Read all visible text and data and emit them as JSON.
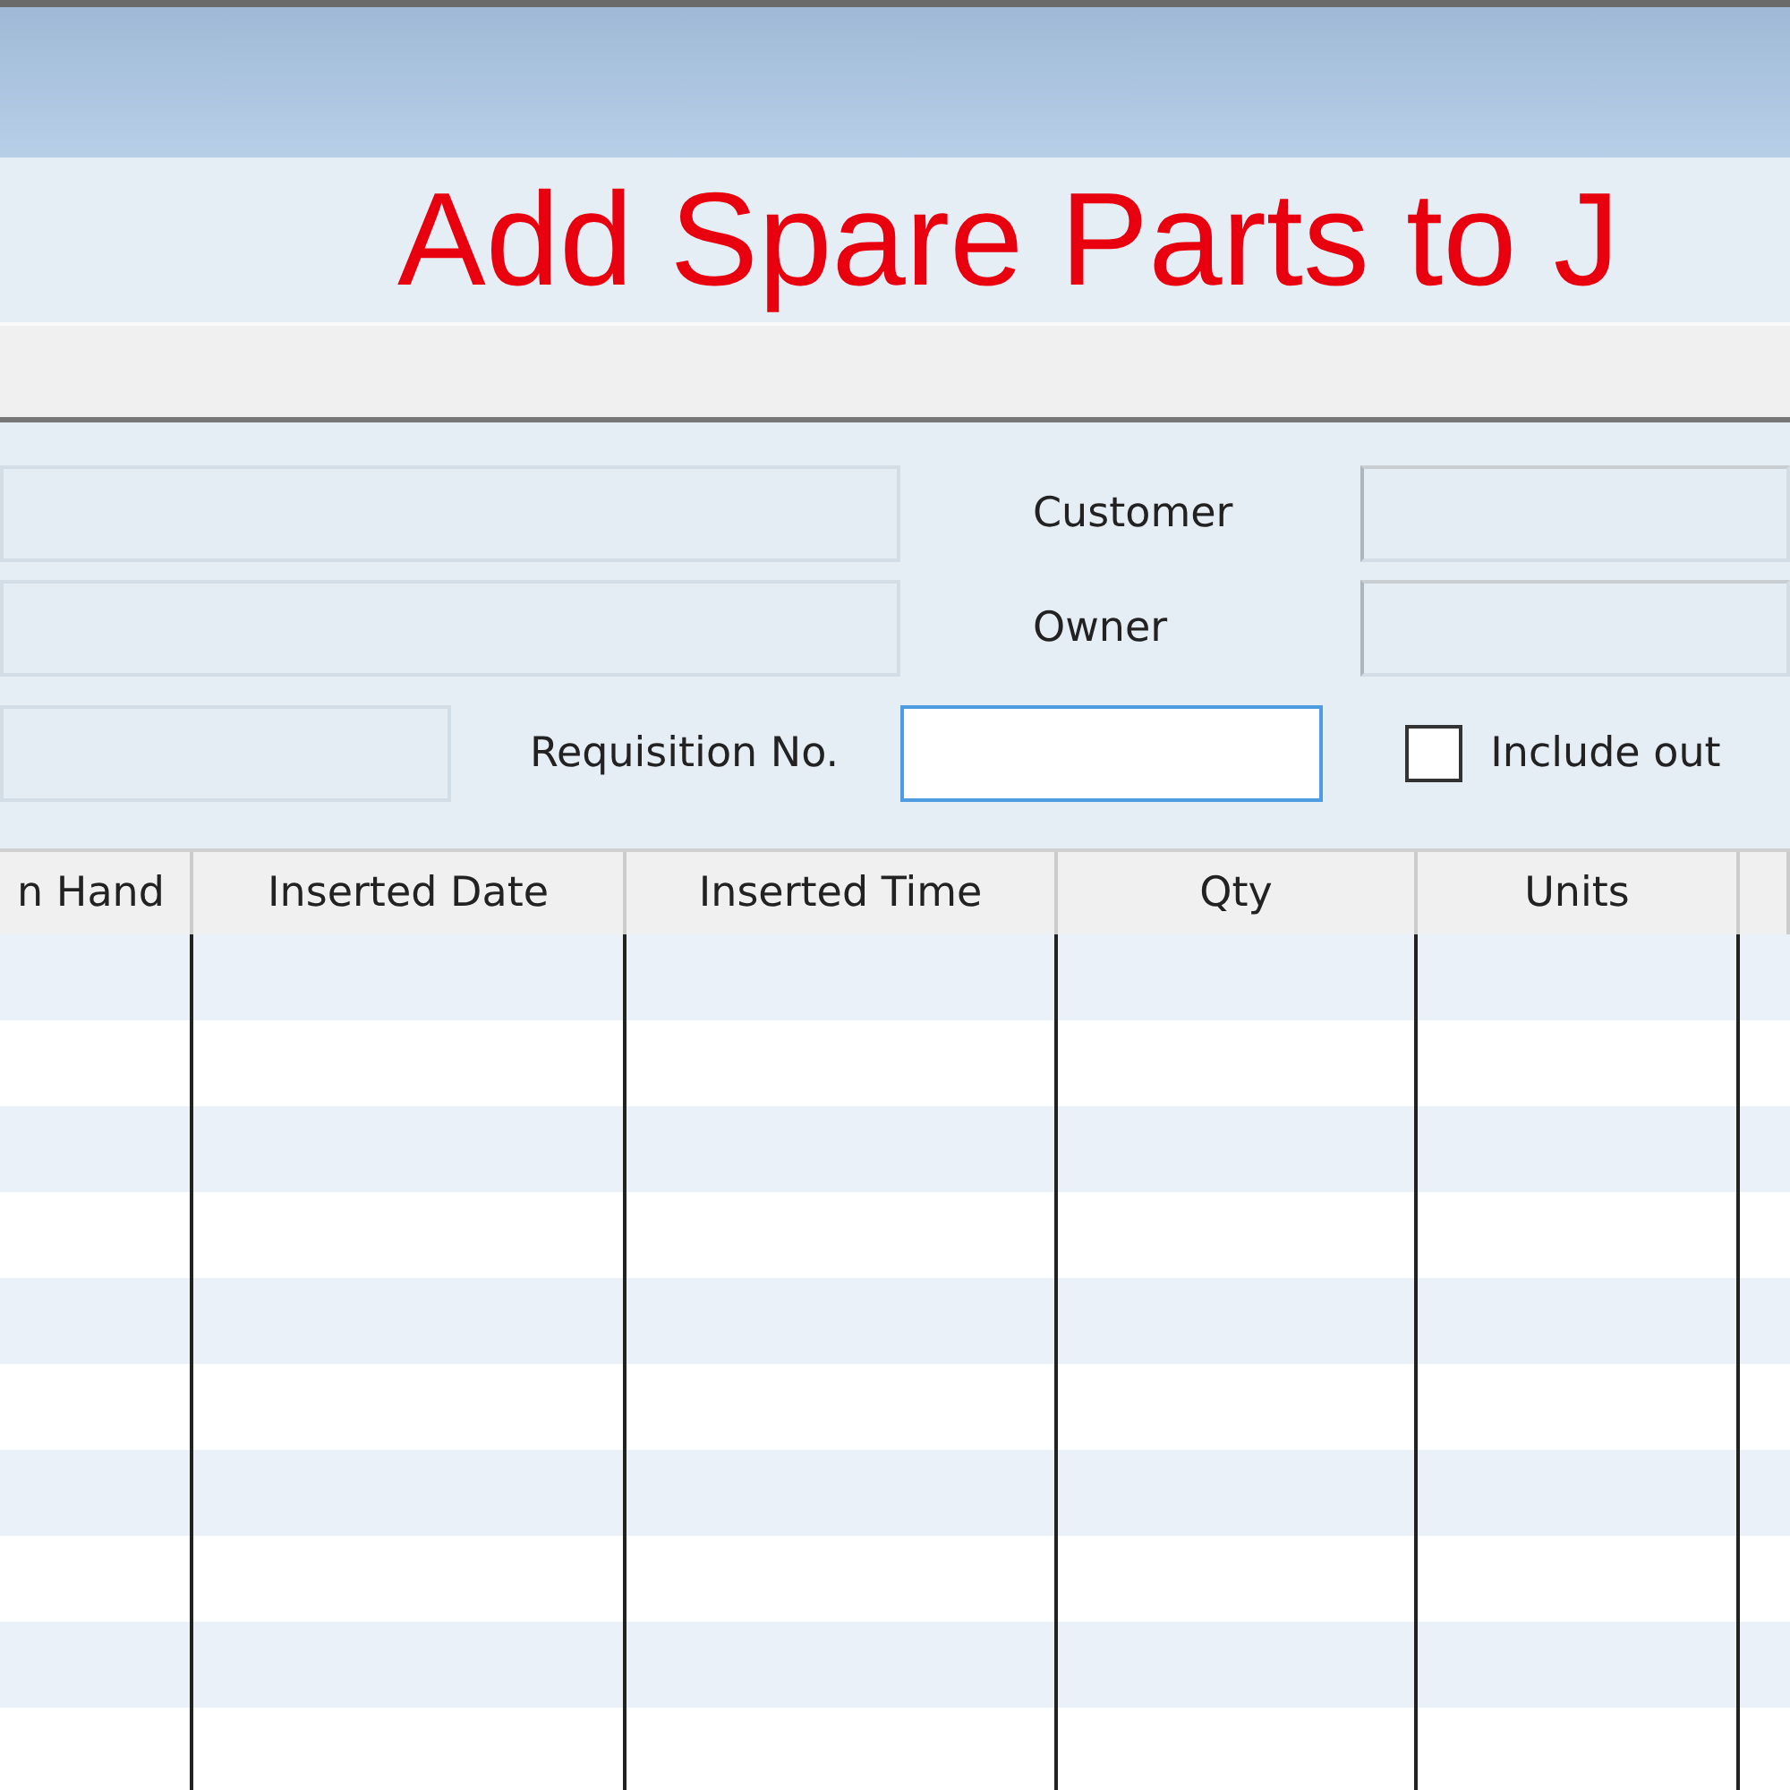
{
  "header": {
    "title": "Add Spare Parts to J"
  },
  "form": {
    "customer_label": "Customer",
    "owner_label": "Owner",
    "requisition_label": "Requisition No.",
    "include_checkbox": {
      "label": "Include out",
      "checked": false
    }
  },
  "table": {
    "columns": [
      "n Hand",
      "Inserted Date",
      "Inserted Time",
      "Qty",
      "Units",
      ""
    ]
  }
}
